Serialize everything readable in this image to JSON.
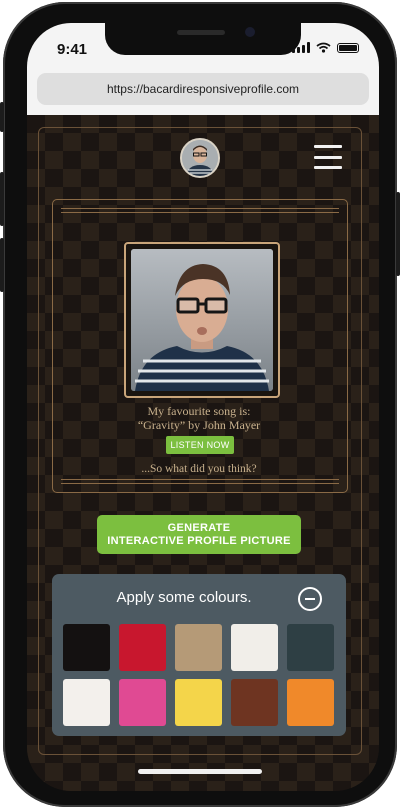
{
  "status_bar": {
    "time": "9:41"
  },
  "browser": {
    "url": "https://bacardiresponsiveprofile.com"
  },
  "profile": {
    "favourite_line": "My favourite song is:",
    "song_line": "“Gravity” by John Mayer",
    "listen_label": "LISTEN NOW",
    "question": "...So what did you think?"
  },
  "generate": {
    "line1": "GENERATE",
    "line2": "INTERACTIVE PROFILE PICTURE"
  },
  "colours_panel": {
    "title": "Apply some colours.",
    "swatches": [
      {
        "name": "black",
        "color": "#141111"
      },
      {
        "name": "red",
        "color": "#c8172e"
      },
      {
        "name": "tan",
        "color": "#b59a77"
      },
      {
        "name": "off-white",
        "color": "#f1eee9"
      },
      {
        "name": "dark-slate",
        "color": "#2e3f44"
      },
      {
        "name": "white",
        "color": "#f3f0ec"
      },
      {
        "name": "pink",
        "color": "#e04a93"
      },
      {
        "name": "yellow",
        "color": "#f4d54a"
      },
      {
        "name": "brown",
        "color": "#6e3421"
      },
      {
        "name": "orange",
        "color": "#f0892a"
      }
    ]
  },
  "colors": {
    "accent_green": "#7cbf3f",
    "gold_text": "#c8b18d",
    "panel_bg": "#4d5a62"
  }
}
